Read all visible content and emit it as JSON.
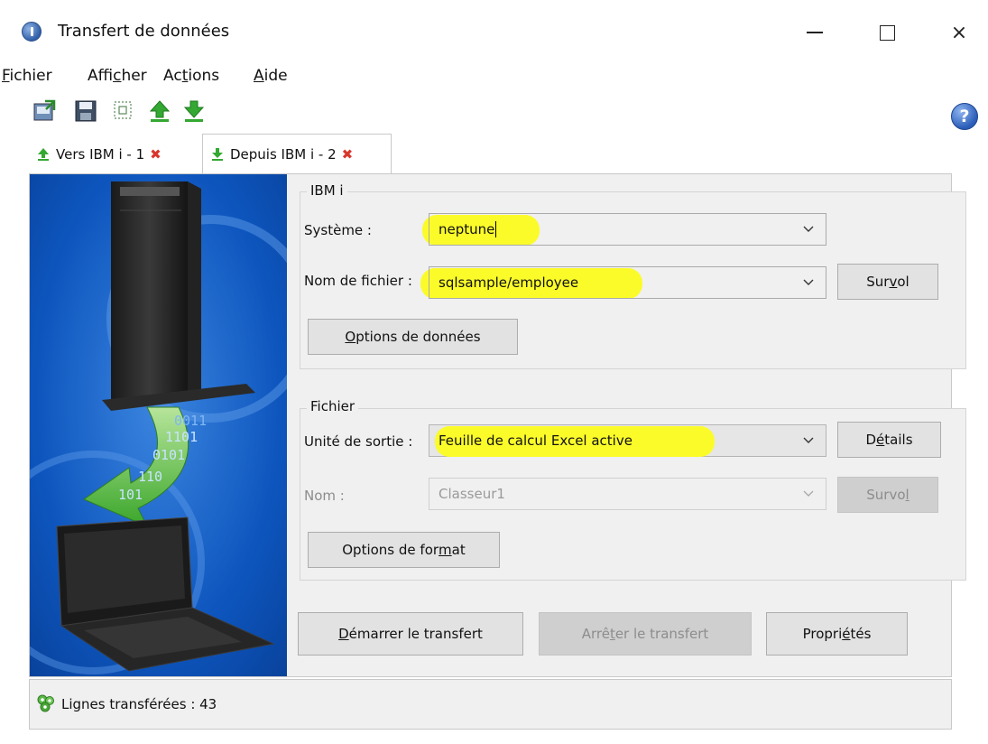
{
  "window": {
    "title": "Transfert de données",
    "controls": {
      "minimize": "minimize",
      "maximize": "maximize",
      "close": "×"
    }
  },
  "menu": [
    {
      "pre": "",
      "u": "F",
      "post": "ichier"
    },
    {
      "pre": "Affi",
      "u": "c",
      "post": "her"
    },
    {
      "pre": "Ac",
      "u": "t",
      "post": "ions"
    },
    {
      "pre": "",
      "u": "A",
      "post": "ide"
    }
  ],
  "toolbar": {
    "icons": [
      "open-icon",
      "save-icon",
      "select-icon",
      "upload-icon",
      "download-icon"
    ],
    "help": "?"
  },
  "tabs": [
    {
      "label": "Vers IBM i - 1",
      "active": false
    },
    {
      "label": "Depuis IBM i - 2",
      "active": true
    }
  ],
  "illustration": {
    "binary_lines": [
      "0011",
      "1101",
      "0101",
      "110",
      "101"
    ]
  },
  "ibmi_group": {
    "legend": "IBM i",
    "system_label": "Système :",
    "system_value": "neptune",
    "file_label": "Nom de fichier :",
    "file_value": "sqlsample/employee",
    "browse_button": {
      "pre": "Sur",
      "u": "v",
      "post": "ol"
    },
    "data_options_button": {
      "pre": "",
      "u": "O",
      "post": "ptions de données"
    }
  },
  "fichier_group": {
    "legend": "Fichier",
    "output_label": "Unité de sortie :",
    "output_value": "Feuille de calcul Excel active",
    "details_button": {
      "pre": "D",
      "u": "é",
      "post": "tails"
    },
    "name_label": "Nom :",
    "name_value": "Classeur1",
    "browse_button": {
      "pre": "Survo",
      "u": "l",
      "post": ""
    },
    "format_options_button": {
      "pre": "Options de for",
      "u": "m",
      "post": "at"
    }
  },
  "actions": {
    "start": {
      "pre": "",
      "u": "D",
      "post": "émarrer le transfert"
    },
    "stop": {
      "pre": "Arrê",
      "u": "t",
      "post": "er le transfert"
    },
    "properties": {
      "pre": "Propri",
      "u": "é",
      "post": "tés"
    }
  },
  "status": {
    "text": "Lignes transférées : 43"
  },
  "colors": {
    "highlight": "#fbfb2a",
    "panel": "#f0f0f0",
    "illustration_blue": "#0a4fb6",
    "arrow_green": "#5fc43a",
    "tab_close_red": "#d9362b"
  }
}
